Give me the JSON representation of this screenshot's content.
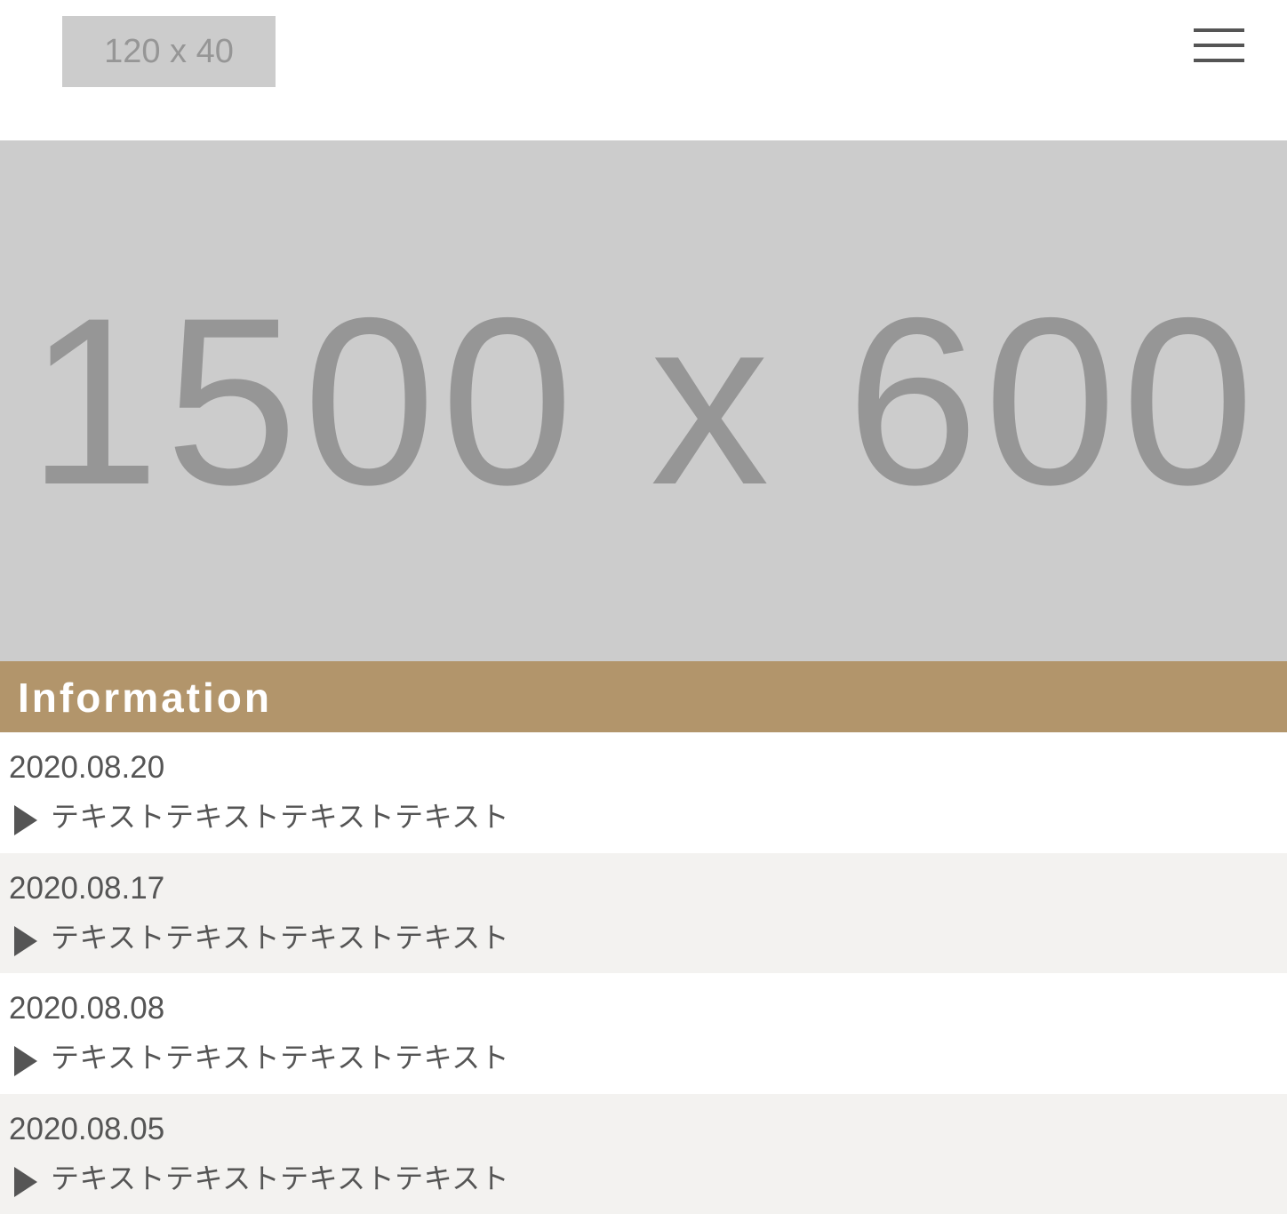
{
  "header": {
    "logo_text": "120 x 40",
    "menu_icon": "hamburger-menu-icon"
  },
  "hero": {
    "placeholder_text": "1500 x 600"
  },
  "information": {
    "title": "Information",
    "accent_color": "#b2956b",
    "items": [
      {
        "date": "2020.08.20",
        "text": "テキストテキストテキストテキスト"
      },
      {
        "date": "2020.08.17",
        "text": "テキストテキストテキストテキスト"
      },
      {
        "date": "2020.08.08",
        "text": "テキストテキストテキストテキスト"
      },
      {
        "date": "2020.08.05",
        "text": "テキストテキストテキストテキスト"
      }
    ]
  }
}
